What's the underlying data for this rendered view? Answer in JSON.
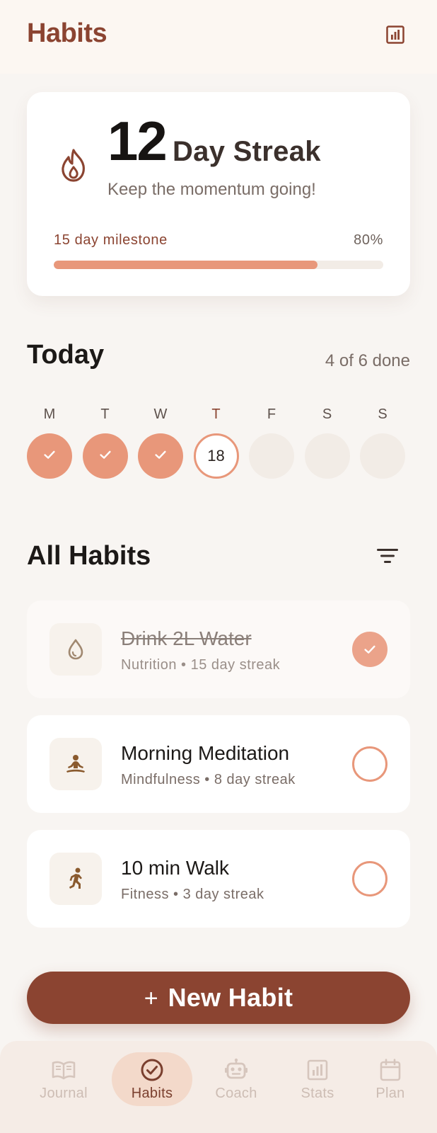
{
  "header": {
    "title": "Habits",
    "action_icon": "bar-chart-icon"
  },
  "streak": {
    "number": "12",
    "label": "Day Streak",
    "subtitle": "Keep the momentum going!",
    "milestone_label": "15 day milestone",
    "milestone_percent_text": "80%",
    "progress": 0.8,
    "icon": "flame-icon"
  },
  "today": {
    "title": "Today",
    "count": "4 of 6 done",
    "days": [
      {
        "letter": "M",
        "state": "done",
        "num": ""
      },
      {
        "letter": "T",
        "state": "done",
        "num": ""
      },
      {
        "letter": "W",
        "state": "done",
        "num": ""
      },
      {
        "letter": "T",
        "state": "today",
        "num": "18"
      },
      {
        "letter": "F",
        "state": "future",
        "num": ""
      },
      {
        "letter": "S",
        "state": "future",
        "num": ""
      },
      {
        "letter": "S",
        "state": "future",
        "num": ""
      }
    ]
  },
  "all_habits": {
    "title": "All Habits",
    "filter_icon": "filter-icon",
    "items": [
      {
        "name": "Drink 2L Water",
        "meta": "Nutrition  •  15 day streak",
        "completed": true,
        "icon": "water-drop-icon"
      },
      {
        "name": "Morning Meditation",
        "meta": "Mindfulness  •  8 day streak",
        "completed": false,
        "icon": "meditation-icon"
      },
      {
        "name": "10 min Walk",
        "meta": "Fitness  •  3 day streak",
        "completed": false,
        "icon": "walking-icon"
      }
    ]
  },
  "new_habit": {
    "plus": "+",
    "label": "New Habit"
  },
  "nav": {
    "items": [
      {
        "label": "Journal",
        "icon": "book-icon",
        "active": false
      },
      {
        "label": "Habits",
        "icon": "check-circle-icon",
        "active": true
      },
      {
        "label": "Coach",
        "icon": "robot-icon",
        "active": false
      },
      {
        "label": "Stats",
        "icon": "bar-chart-icon",
        "active": false
      },
      {
        "label": "Plan",
        "icon": "calendar-icon",
        "active": false
      }
    ]
  },
  "colors": {
    "brand": "#8b4431",
    "accent": "#e8977a",
    "background": "#f8f5f2"
  }
}
